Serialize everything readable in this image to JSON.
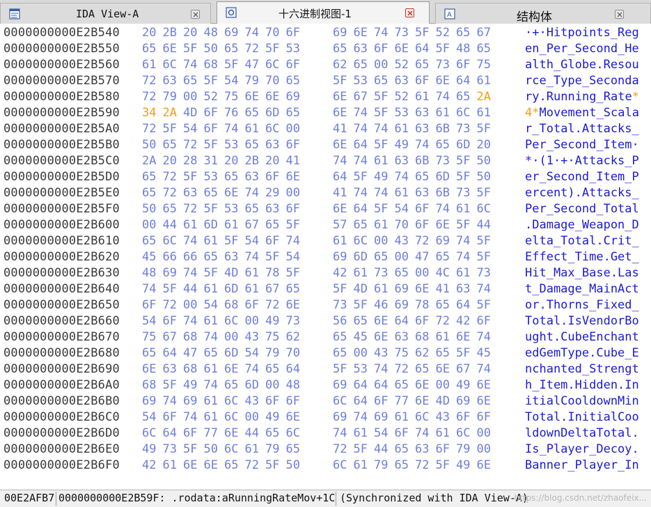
{
  "tabs": [
    {
      "label": "IDA View-A",
      "icon": "ida-view-icon",
      "active": false
    },
    {
      "label": "十六进制视图-1",
      "icon": "hex-view-icon",
      "active": true
    },
    {
      "label": "结构体",
      "icon": "structures-icon",
      "active": false
    }
  ],
  "hex_rows": [
    {
      "address": "0000000000E2B540",
      "bytes": [
        "20",
        "2B",
        "20",
        "48",
        "69",
        "74",
        "70",
        "6F",
        "69",
        "6E",
        "74",
        "73",
        "5F",
        "52",
        "65",
        "67"
      ],
      "ascii": "·+·Hitpoints_Reg"
    },
    {
      "address": "0000000000E2B550",
      "bytes": [
        "65",
        "6E",
        "5F",
        "50",
        "65",
        "72",
        "5F",
        "53",
        "65",
        "63",
        "6F",
        "6E",
        "64",
        "5F",
        "48",
        "65"
      ],
      "ascii": "en_Per_Second_He"
    },
    {
      "address": "0000000000E2B560",
      "bytes": [
        "61",
        "6C",
        "74",
        "68",
        "5F",
        "47",
        "6C",
        "6F",
        "62",
        "65",
        "00",
        "52",
        "65",
        "73",
        "6F",
        "75"
      ],
      "ascii": "alth_Globe.Resou"
    },
    {
      "address": "0000000000E2B570",
      "bytes": [
        "72",
        "63",
        "65",
        "5F",
        "54",
        "79",
        "70",
        "65",
        "5F",
        "53",
        "65",
        "63",
        "6F",
        "6E",
        "64",
        "61"
      ],
      "ascii": "rce_Type_Seconda"
    },
    {
      "address": "0000000000E2B580",
      "bytes": [
        "72",
        "79",
        "00",
        "52",
        "75",
        "6E",
        "6E",
        "69",
        "6E",
        "67",
        "5F",
        "52",
        "61",
        "74",
        "65",
        "2A"
      ],
      "ascii": "ry.Running_Rate*"
    },
    {
      "address": "0000000000E2B590",
      "bytes": [
        "34",
        "2A",
        "4D",
        "6F",
        "76",
        "65",
        "6D",
        "65",
        "6E",
        "74",
        "5F",
        "53",
        "63",
        "61",
        "6C",
        "61"
      ],
      "ascii": "4*Movement_Scala"
    },
    {
      "address": "0000000000E2B5A0",
      "bytes": [
        "72",
        "5F",
        "54",
        "6F",
        "74",
        "61",
        "6C",
        "00",
        "41",
        "74",
        "74",
        "61",
        "63",
        "6B",
        "73",
        "5F"
      ],
      "ascii": "r_Total.Attacks_"
    },
    {
      "address": "0000000000E2B5B0",
      "bytes": [
        "50",
        "65",
        "72",
        "5F",
        "53",
        "65",
        "63",
        "6F",
        "6E",
        "64",
        "5F",
        "49",
        "74",
        "65",
        "6D",
        "20"
      ],
      "ascii": "Per_Second_Item·"
    },
    {
      "address": "0000000000E2B5C0",
      "bytes": [
        "2A",
        "20",
        "28",
        "31",
        "20",
        "2B",
        "20",
        "41",
        "74",
        "74",
        "61",
        "63",
        "6B",
        "73",
        "5F",
        "50"
      ],
      "ascii": "*·(1·+·Attacks_P"
    },
    {
      "address": "0000000000E2B5D0",
      "bytes": [
        "65",
        "72",
        "5F",
        "53",
        "65",
        "63",
        "6F",
        "6E",
        "64",
        "5F",
        "49",
        "74",
        "65",
        "6D",
        "5F",
        "50"
      ],
      "ascii": "er_Second_Item_P"
    },
    {
      "address": "0000000000E2B5E0",
      "bytes": [
        "65",
        "72",
        "63",
        "65",
        "6E",
        "74",
        "29",
        "00",
        "41",
        "74",
        "74",
        "61",
        "63",
        "6B",
        "73",
        "5F"
      ],
      "ascii": "ercent).Attacks_"
    },
    {
      "address": "0000000000E2B5F0",
      "bytes": [
        "50",
        "65",
        "72",
        "5F",
        "53",
        "65",
        "63",
        "6F",
        "6E",
        "64",
        "5F",
        "54",
        "6F",
        "74",
        "61",
        "6C"
      ],
      "ascii": "Per_Second_Total"
    },
    {
      "address": "0000000000E2B600",
      "bytes": [
        "00",
        "44",
        "61",
        "6D",
        "61",
        "67",
        "65",
        "5F",
        "57",
        "65",
        "61",
        "70",
        "6F",
        "6E",
        "5F",
        "44"
      ],
      "ascii": ".Damage_Weapon_D"
    },
    {
      "address": "0000000000E2B610",
      "bytes": [
        "65",
        "6C",
        "74",
        "61",
        "5F",
        "54",
        "6F",
        "74",
        "61",
        "6C",
        "00",
        "43",
        "72",
        "69",
        "74",
        "5F"
      ],
      "ascii": "elta_Total.Crit_"
    },
    {
      "address": "0000000000E2B620",
      "bytes": [
        "45",
        "66",
        "66",
        "65",
        "63",
        "74",
        "5F",
        "54",
        "69",
        "6D",
        "65",
        "00",
        "47",
        "65",
        "74",
        "5F"
      ],
      "ascii": "Effect_Time.Get_"
    },
    {
      "address": "0000000000E2B630",
      "bytes": [
        "48",
        "69",
        "74",
        "5F",
        "4D",
        "61",
        "78",
        "5F",
        "42",
        "61",
        "73",
        "65",
        "00",
        "4C",
        "61",
        "73"
      ],
      "ascii": "Hit_Max_Base.Las"
    },
    {
      "address": "0000000000E2B640",
      "bytes": [
        "74",
        "5F",
        "44",
        "61",
        "6D",
        "61",
        "67",
        "65",
        "5F",
        "4D",
        "61",
        "69",
        "6E",
        "41",
        "63",
        "74"
      ],
      "ascii": "t_Damage_MainAct"
    },
    {
      "address": "0000000000E2B650",
      "bytes": [
        "6F",
        "72",
        "00",
        "54",
        "68",
        "6F",
        "72",
        "6E",
        "73",
        "5F",
        "46",
        "69",
        "78",
        "65",
        "64",
        "5F"
      ],
      "ascii": "or.Thorns_Fixed_"
    },
    {
      "address": "0000000000E2B660",
      "bytes": [
        "54",
        "6F",
        "74",
        "61",
        "6C",
        "00",
        "49",
        "73",
        "56",
        "65",
        "6E",
        "64",
        "6F",
        "72",
        "42",
        "6F"
      ],
      "ascii": "Total.IsVendorBo"
    },
    {
      "address": "0000000000E2B670",
      "bytes": [
        "75",
        "67",
        "68",
        "74",
        "00",
        "43",
        "75",
        "62",
        "65",
        "45",
        "6E",
        "63",
        "68",
        "61",
        "6E",
        "74"
      ],
      "ascii": "ught.CubeEnchant"
    },
    {
      "address": "0000000000E2B680",
      "bytes": [
        "65",
        "64",
        "47",
        "65",
        "6D",
        "54",
        "79",
        "70",
        "65",
        "00",
        "43",
        "75",
        "62",
        "65",
        "5F",
        "45"
      ],
      "ascii": "edGemType.Cube_E"
    },
    {
      "address": "0000000000E2B690",
      "bytes": [
        "6E",
        "63",
        "68",
        "61",
        "6E",
        "74",
        "65",
        "64",
        "5F",
        "53",
        "74",
        "72",
        "65",
        "6E",
        "67",
        "74"
      ],
      "ascii": "nchanted_Strengt"
    },
    {
      "address": "0000000000E2B6A0",
      "bytes": [
        "68",
        "5F",
        "49",
        "74",
        "65",
        "6D",
        "00",
        "48",
        "69",
        "64",
        "64",
        "65",
        "6E",
        "00",
        "49",
        "6E"
      ],
      "ascii": "h_Item.Hidden.In"
    },
    {
      "address": "0000000000E2B6B0",
      "bytes": [
        "69",
        "74",
        "69",
        "61",
        "6C",
        "43",
        "6F",
        "6F",
        "6C",
        "64",
        "6F",
        "77",
        "6E",
        "4D",
        "69",
        "6E"
      ],
      "ascii": "itialCooldownMin"
    },
    {
      "address": "0000000000E2B6C0",
      "bytes": [
        "54",
        "6F",
        "74",
        "61",
        "6C",
        "00",
        "49",
        "6E",
        "69",
        "74",
        "69",
        "61",
        "6C",
        "43",
        "6F",
        "6F"
      ],
      "ascii": "Total.InitialCoo"
    },
    {
      "address": "0000000000E2B6D0",
      "bytes": [
        "6C",
        "64",
        "6F",
        "77",
        "6E",
        "44",
        "65",
        "6C",
        "74",
        "61",
        "54",
        "6F",
        "74",
        "61",
        "6C",
        "00"
      ],
      "ascii": "ldownDeltaTotal."
    },
    {
      "address": "0000000000E2B6E0",
      "bytes": [
        "49",
        "73",
        "5F",
        "50",
        "6C",
        "61",
        "79",
        "65",
        "72",
        "5F",
        "44",
        "65",
        "63",
        "6F",
        "79",
        "00"
      ],
      "ascii": "Is_Player_Decoy."
    },
    {
      "address": "0000000000E2B6F0",
      "bytes": [
        "42",
        "61",
        "6E",
        "6E",
        "65",
        "72",
        "5F",
        "50",
        "6C",
        "61",
        "79",
        "65",
        "72",
        "5F",
        "49",
        "6E"
      ],
      "ascii": "Banner_Player_In"
    }
  ],
  "highlight": {
    "start_address": "0000000000E2B58F",
    "length": 3,
    "color": "#f39c12"
  },
  "colors": {
    "hex_bytes": "#6f7edb",
    "ascii": "#1b1bd1",
    "address": "#3a3a3a",
    "highlight": "#f39c12"
  },
  "status": {
    "offset": "00E2AFB7",
    "location": "0000000000E2B59F: .rodata:aRunningRateMov+1C",
    "sync": "(Synchronized with IDA View-A)",
    "watermark": "https://blog.csdn.net/zhaofeix..."
  }
}
